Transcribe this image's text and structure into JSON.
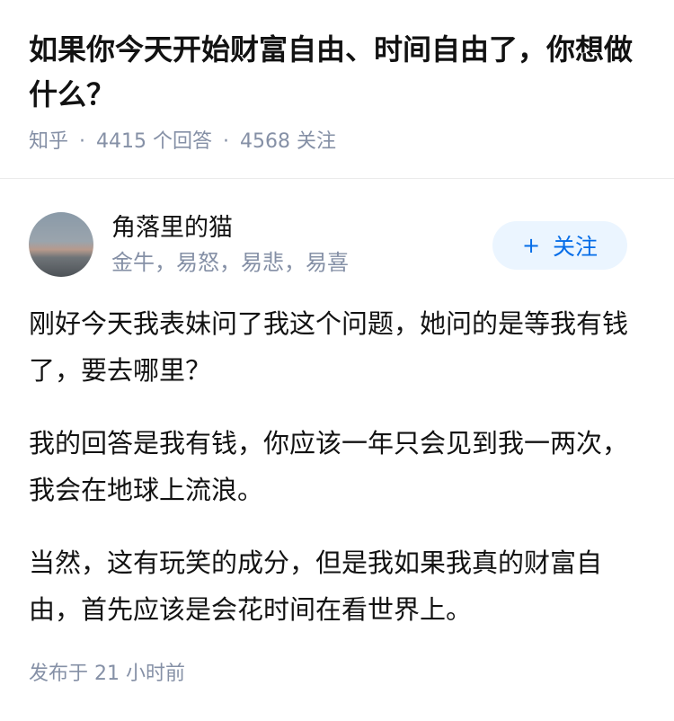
{
  "question": {
    "title": "如果你今天开始财富自由、时间自由了，你想做什么？",
    "site": "知乎",
    "separator": "·",
    "answer_count": "4415 个回答",
    "follower_count": "4568 关注"
  },
  "author": {
    "name": "角落里的猫",
    "bio": "金牛，易怒，易悲，易喜",
    "follow_icon": "+",
    "follow_label": "关注"
  },
  "answer": {
    "paragraphs": [
      "刚好今天我表妹问了我这个问题，她问的是等我有钱了，要去哪里？",
      "我的回答是我有钱，你应该一年只会见到我一两次，我会在地球上流浪。",
      "当然，这有玩笑的成分，但是我如果我真的财富自由，首先应该是会花时间在看世界上。"
    ],
    "published": "发布于 21 小时前"
  },
  "colors": {
    "text": "#121212",
    "meta": "#8590a6",
    "accent": "#056de8",
    "accent_bg": "#ebf5ff"
  }
}
